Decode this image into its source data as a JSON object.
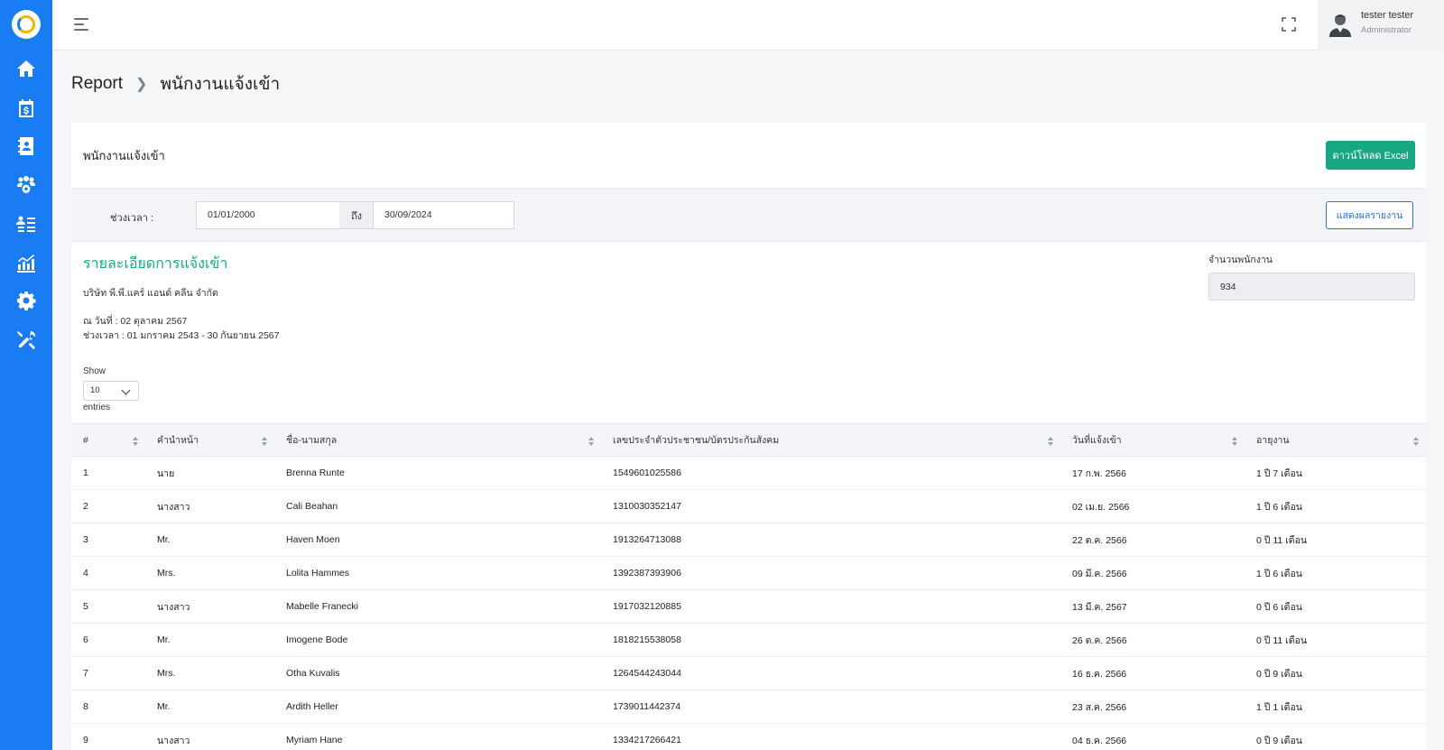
{
  "sidebar": {
    "logo": "app-logo",
    "items": [
      {
        "name": "home-icon"
      },
      {
        "name": "calendar-money-icon"
      },
      {
        "name": "contact-book-icon"
      },
      {
        "name": "team-gear-icon"
      },
      {
        "name": "employee-list-icon"
      },
      {
        "name": "report-chart-icon"
      },
      {
        "name": "settings-gear-icon"
      },
      {
        "name": "tools-icon"
      }
    ]
  },
  "topbar": {
    "user_name": "tester tester",
    "user_role": "Administrator"
  },
  "breadcrumb": {
    "root": "Report",
    "current": "พนักงานแจ้งเข้า"
  },
  "card": {
    "title": "พนักงานแจ้งเข้า",
    "excel_button": "ดาวน์โหลด Excel"
  },
  "filter": {
    "period_label": "ช่วงเวลา :",
    "date_from": "01/01/2000",
    "to_label": "ถึง",
    "date_to": "30/09/2024",
    "show_button": "แสดงผลรายงาน"
  },
  "report": {
    "title": "รายละเอียดการแจ้งเข้า",
    "company": "บริษัท พี.พี.แคร์ แอนด์ คลีน จำกัด",
    "as_of": "ณ วันที่ : 02 ตุลาคม 2567",
    "range": "ช่วงเวลา : 01 มกราคม 2543 - 30 กันยายน 2567",
    "employee_count_label": "จำนวนพนักงาน",
    "employee_count": "934"
  },
  "pagination": {
    "show_label": "Show",
    "page_size": "10",
    "entries_label": "entries"
  },
  "table": {
    "columns": [
      "#",
      "คำนำหน้า",
      "ชื่อ-นามสกุล",
      "เลขประจำตัวประชาชน/บัตรประกันสังคม",
      "วันที่แจ้งเข้า",
      "อายุงาน"
    ],
    "rows": [
      [
        "1",
        "นาย",
        "Brenna Runte",
        "1549601025586",
        "17 ก.พ. 2566",
        "1 ปี 7 เดือน"
      ],
      [
        "2",
        "นางสาว",
        "Cali Beahan",
        "1310030352147",
        "02 เม.ย. 2566",
        "1 ปี 6 เดือน"
      ],
      [
        "3",
        "Mr.",
        "Haven Moen",
        "1913264713088",
        "22 ต.ค. 2566",
        "0 ปี 11 เดือน"
      ],
      [
        "4",
        "Mrs.",
        "Lolita Hammes",
        "1392387393906",
        "09 มี.ค. 2566",
        "1 ปี 6 เดือน"
      ],
      [
        "5",
        "นางสาว",
        "Mabelle Franecki",
        "1917032120885",
        "13 มี.ค. 2567",
        "0 ปี 6 เดือน"
      ],
      [
        "6",
        "Mr.",
        "Imogene Bode",
        "1818215538058",
        "26 ต.ค. 2566",
        "0 ปี 11 เดือน"
      ],
      [
        "7",
        "Mrs.",
        "Otha Kuvalis",
        "1264544243044",
        "16 ธ.ค. 2566",
        "0 ปี 9 เดือน"
      ],
      [
        "8",
        "Mr.",
        "Ardith Heller",
        "1739011442374",
        "23 ส.ค. 2566",
        "1 ปี 1 เดือน"
      ],
      [
        "9",
        "นางสาว",
        "Myriam Hane",
        "1334217266421",
        "04 ธ.ค. 2566",
        "0 ปี 9 เดือน"
      ]
    ]
  }
}
